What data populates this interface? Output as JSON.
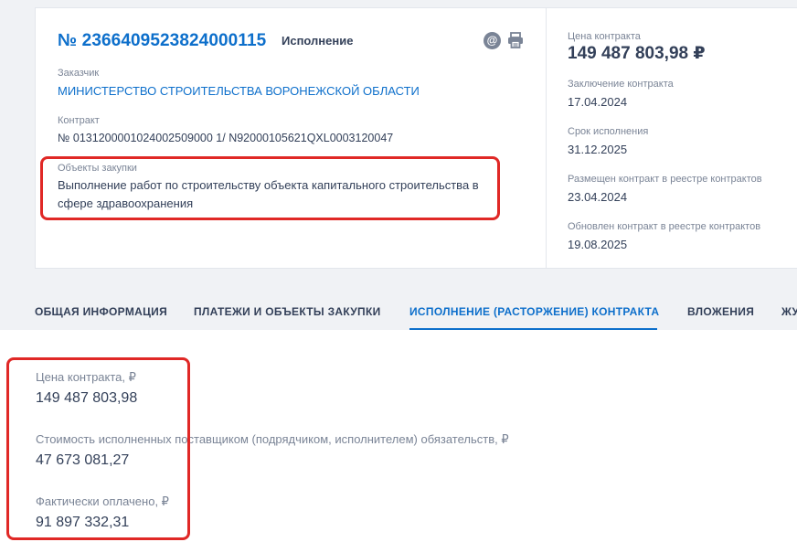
{
  "card": {
    "reg_number": "№ 2366409523824000115",
    "status": "Исполнение",
    "customer_label": "Заказчик",
    "customer_value": "МИНИСТЕРСТВО СТРОИТЕЛЬСТВА ВОРОНЕЖСКОЙ ОБЛАСТИ",
    "contract_label": "Контракт",
    "contract_value": "№ 0131200001024002509000 1/ N92000105621QXL0003120047",
    "objects_label": "Объекты закупки",
    "objects_value": "Выполнение работ по строительству объекта капитального строительства в сфере здравоохранения"
  },
  "side": {
    "price_label": "Цена контракта",
    "price_value": "149 487 803,98 ₽",
    "conclusion_label": "Заключение контракта",
    "conclusion_value": "17.04.2024",
    "deadline_label": "Срок исполнения",
    "deadline_value": "31.12.2025",
    "placed_label": "Размещен контракт в реестре контрактов",
    "placed_value": "23.04.2024",
    "updated_label": "Обновлен контракт в реестре контрактов",
    "updated_value": "19.08.2025"
  },
  "tabs": [
    {
      "label": "ОБЩАЯ ИНФОРМАЦИЯ",
      "active": false
    },
    {
      "label": "ПЛАТЕЖИ И ОБЪЕКТЫ ЗАКУПКИ",
      "active": false
    },
    {
      "label": "ИСПОЛНЕНИЕ (РАСТОРЖЕНИЕ) КОНТРАКТА",
      "active": true
    },
    {
      "label": "ВЛОЖЕНИЯ",
      "active": false
    },
    {
      "label": "ЖУ",
      "active": false
    }
  ],
  "execution": {
    "price_label": "Цена контракта, ₽",
    "price_value": "149 487 803,98",
    "fulfilled_label": "Стоимость исполненных поставщиком (подрядчиком, исполнителем) обязательств, ₽",
    "fulfilled_value": "47 673 081,27",
    "paid_label": "Фактически оплачено, ₽",
    "paid_value": "91 897 332,31"
  },
  "colors": {
    "accent": "#0d6fcb",
    "highlight": "#e02826",
    "background": "#f0f2f5",
    "text": "#334059",
    "muted": "#7a8496"
  },
  "icons": [
    "email-icon",
    "print-icon"
  ]
}
